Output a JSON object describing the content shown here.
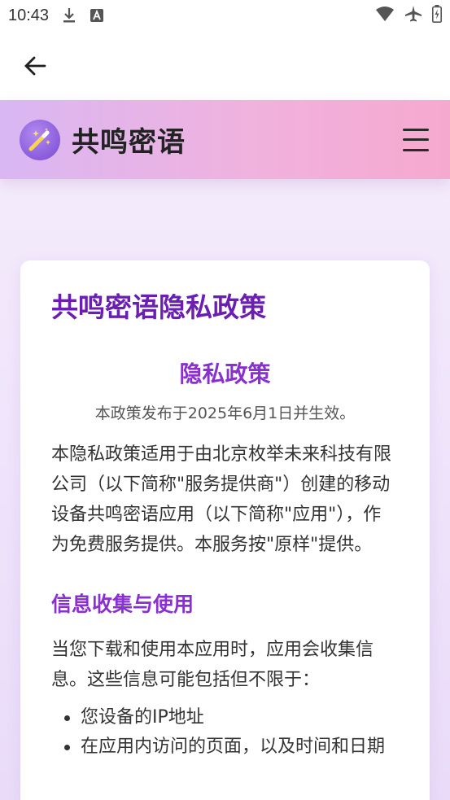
{
  "status_bar": {
    "time": "10:43"
  },
  "header": {
    "brand": "共鸣密语"
  },
  "card": {
    "title": "共鸣密语隐私政策",
    "subtitle": "隐私政策",
    "effective": "本政策发布于2025年6月1日并生效。",
    "intro": "本隐私政策适用于由北京枚举未来科技有限公司（以下简称\"服务提供商\"）创建的移动设备共鸣密语应用（以下简称\"应用\"），作为免费服务提供。本服务按\"原样\"提供。",
    "section1_title": "信息收集与使用",
    "section1_para": "当您下载和使用本应用时，应用会收集信息。这些信息可能包括但不限于：",
    "list": [
      "您设备的IP地址",
      "在应用内访问的页面，以及时间和日期"
    ]
  },
  "colors": {
    "accent_purple": "#6a1fb0",
    "link_purple": "#8a2fd0",
    "header_gradient_start": "#d9b7f3",
    "header_gradient_end": "#f6a9cf"
  },
  "icons": {
    "back": "arrow-left-icon",
    "menu": "hamburger-menu-icon",
    "logo": "magic-wand-icon",
    "download": "download-icon",
    "font": "font-icon",
    "wifi": "wifi-icon",
    "airplane": "airplane-icon",
    "battery": "battery-icon"
  }
}
